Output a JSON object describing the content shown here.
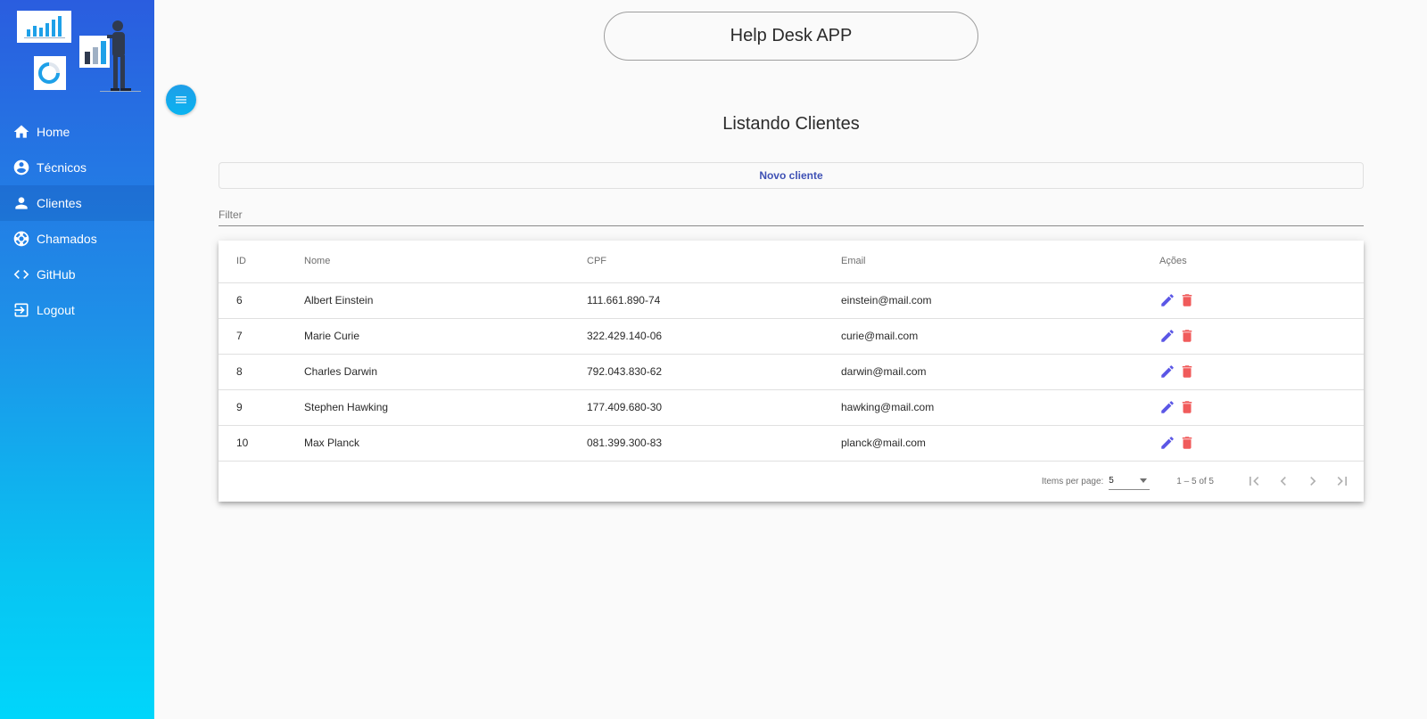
{
  "app": {
    "title": "Help Desk APP"
  },
  "sidebar": {
    "items": [
      {
        "label": "Home",
        "icon": "home-icon"
      },
      {
        "label": "Técnicos",
        "icon": "account-circle-icon"
      },
      {
        "label": "Clientes",
        "icon": "person-icon",
        "active": true
      },
      {
        "label": "Chamados",
        "icon": "support-icon"
      },
      {
        "label": "GitHub",
        "icon": "code-icon"
      },
      {
        "label": "Logout",
        "icon": "logout-icon"
      }
    ]
  },
  "main": {
    "heading": "Listando Clientes",
    "new_button": "Novo cliente",
    "filter": {
      "placeholder": "Filter",
      "value": ""
    },
    "table": {
      "columns": [
        "ID",
        "Nome",
        "CPF",
        "Email",
        "Ações"
      ],
      "rows": [
        {
          "id": "6",
          "nome": "Albert Einstein",
          "cpf": "111.661.890-74",
          "email": "einstein@mail.com"
        },
        {
          "id": "7",
          "nome": "Marie Curie",
          "cpf": "322.429.140-06",
          "email": "curie@mail.com"
        },
        {
          "id": "8",
          "nome": "Charles Darwin",
          "cpf": "792.043.830-62",
          "email": "darwin@mail.com"
        },
        {
          "id": "9",
          "nome": "Stephen Hawking",
          "cpf": "177.409.680-30",
          "email": "hawking@mail.com"
        },
        {
          "id": "10",
          "nome": "Max Planck",
          "cpf": "081.399.300-83",
          "email": "planck@mail.com"
        }
      ]
    },
    "paginator": {
      "items_per_page_label": "Items per page:",
      "items_per_page": "5",
      "range_label": "1 – 5 of 5"
    }
  },
  "colors": {
    "edit_icon": "#5b57e6",
    "delete_icon": "#f05b5b",
    "accent": "#3f51b5",
    "sidebar_top": "#2a5ddf",
    "sidebar_bottom": "#00d6fb"
  }
}
